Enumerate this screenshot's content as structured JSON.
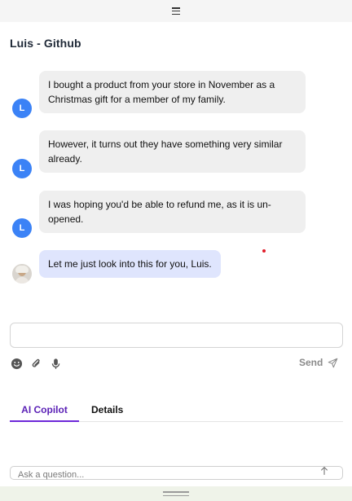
{
  "header": {
    "menu_icon": "hamburger-menu-icon",
    "title": "Luis - Github"
  },
  "conversation": {
    "messages": [
      {
        "sender": "customer",
        "avatar_initial": "L",
        "avatar_color": "#3b82f6",
        "text": "I bought a product from your store in November as a Christmas gift for a member of my family."
      },
      {
        "sender": "customer",
        "avatar_initial": "L",
        "avatar_color": "#3b82f6",
        "text": "However, it turns out they have something very similar already."
      },
      {
        "sender": "customer",
        "avatar_initial": "L",
        "avatar_color": "#3b82f6",
        "text": "I was hoping you'd be able to refund me, as it is un-opened."
      },
      {
        "sender": "agent",
        "avatar": "agent-photo-avatar",
        "bubble_color": "#dfe5fd",
        "text": "Let me just look into this for you, Luis."
      }
    ]
  },
  "composer": {
    "value": "",
    "icons": [
      "emoji-icon",
      "paperclip-icon",
      "microphone-icon"
    ],
    "send_label": "Send",
    "send_icon": "paper-plane-icon"
  },
  "tabs": [
    {
      "label": "AI Copilot",
      "active": true
    },
    {
      "label": "Details",
      "active": false
    }
  ],
  "copilot": {
    "placeholder": "Ask a question...",
    "send_icon": "arrow-up-icon"
  },
  "colors": {
    "accent": "#6d28d9",
    "customer_avatar": "#3b82f6",
    "customer_bubble": "#efefef",
    "agent_bubble": "#dfe5fd",
    "notification_dot": "#e11d2a"
  }
}
